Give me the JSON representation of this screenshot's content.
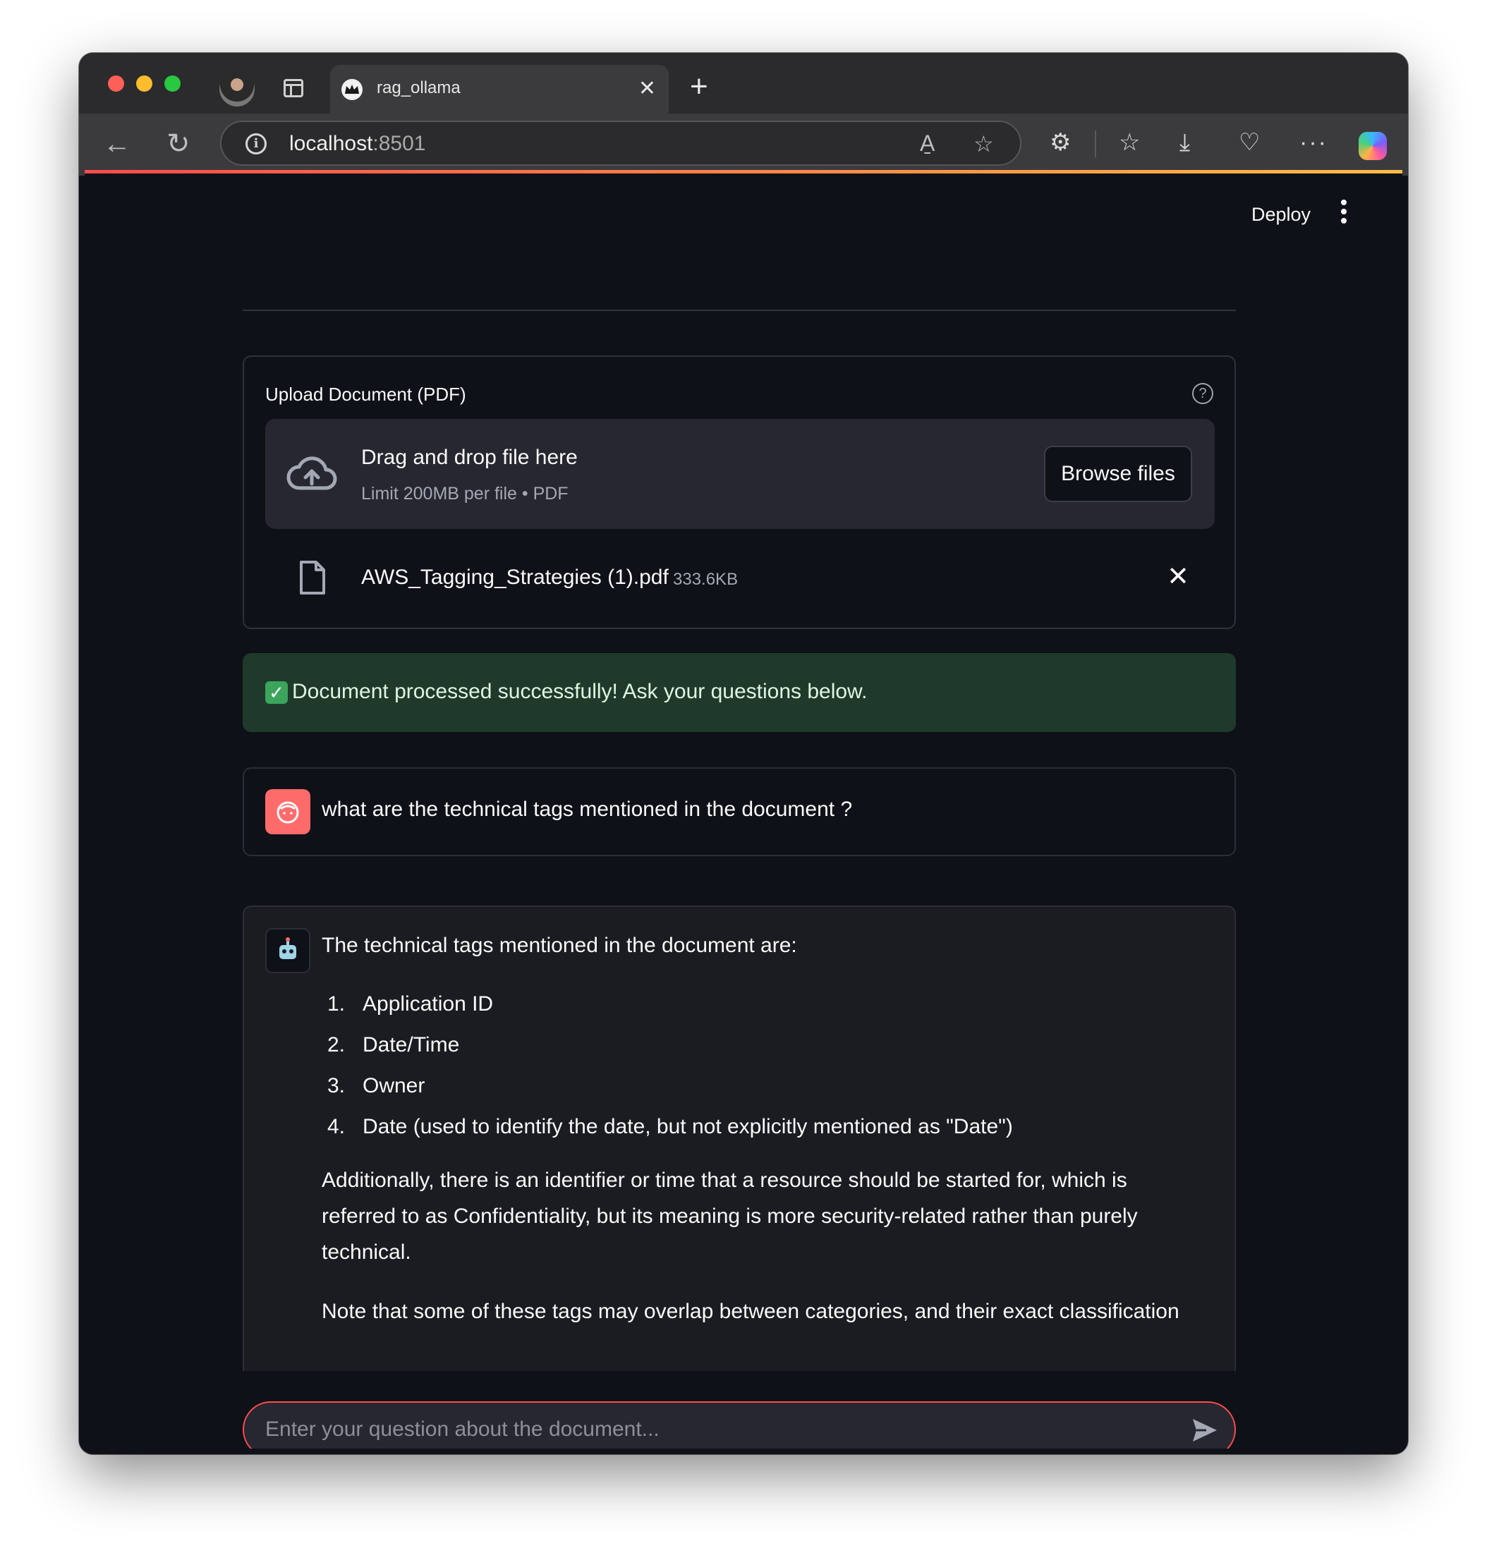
{
  "browser": {
    "tab_title": "rag_ollama",
    "tab_close": "✕",
    "new_tab": "+",
    "address_host": "localhost",
    "address_port": ":8501",
    "reader_mode": "A̱",
    "overflow_menu": "···"
  },
  "app": {
    "deploy_label": "Deploy",
    "uploader": {
      "label": "Upload Document (PDF)",
      "help": "?",
      "dropzone_title": "Drag and drop file here",
      "dropzone_subtitle": "Limit 200MB per file • PDF",
      "browse_label": "Browse files",
      "file": {
        "name": "AWS_Tagging_Strategies (1).pdf",
        "size": "333.6KB"
      }
    },
    "success_message": "Document processed successfully! Ask your questions below.",
    "chat": {
      "user_message": "what are the technical tags mentioned in the document ?",
      "assistant": {
        "intro": "The technical tags mentioned in the document are:",
        "items": [
          {
            "num": "1.",
            "text": "Application ID"
          },
          {
            "num": "2.",
            "text": "Date/Time"
          },
          {
            "num": "3.",
            "text": "Owner"
          },
          {
            "num": "4.",
            "text": "Date (used to identify the date, but not explicitly mentioned as \"Date\")"
          }
        ],
        "paragraph1": "Additionally, there is an identifier or time that a resource should be started for, which is referred to as Confidentiality, but its meaning is more security-related rather than purely technical.",
        "paragraph2": "Note that some of these tags may overlap between categories, and their exact classification"
      },
      "input_placeholder": "Enter your question about the document..."
    }
  },
  "colors": {
    "accent": "#ff4b4b",
    "success_bg": "#1f3a2b",
    "app_bg": "#0e1117"
  }
}
